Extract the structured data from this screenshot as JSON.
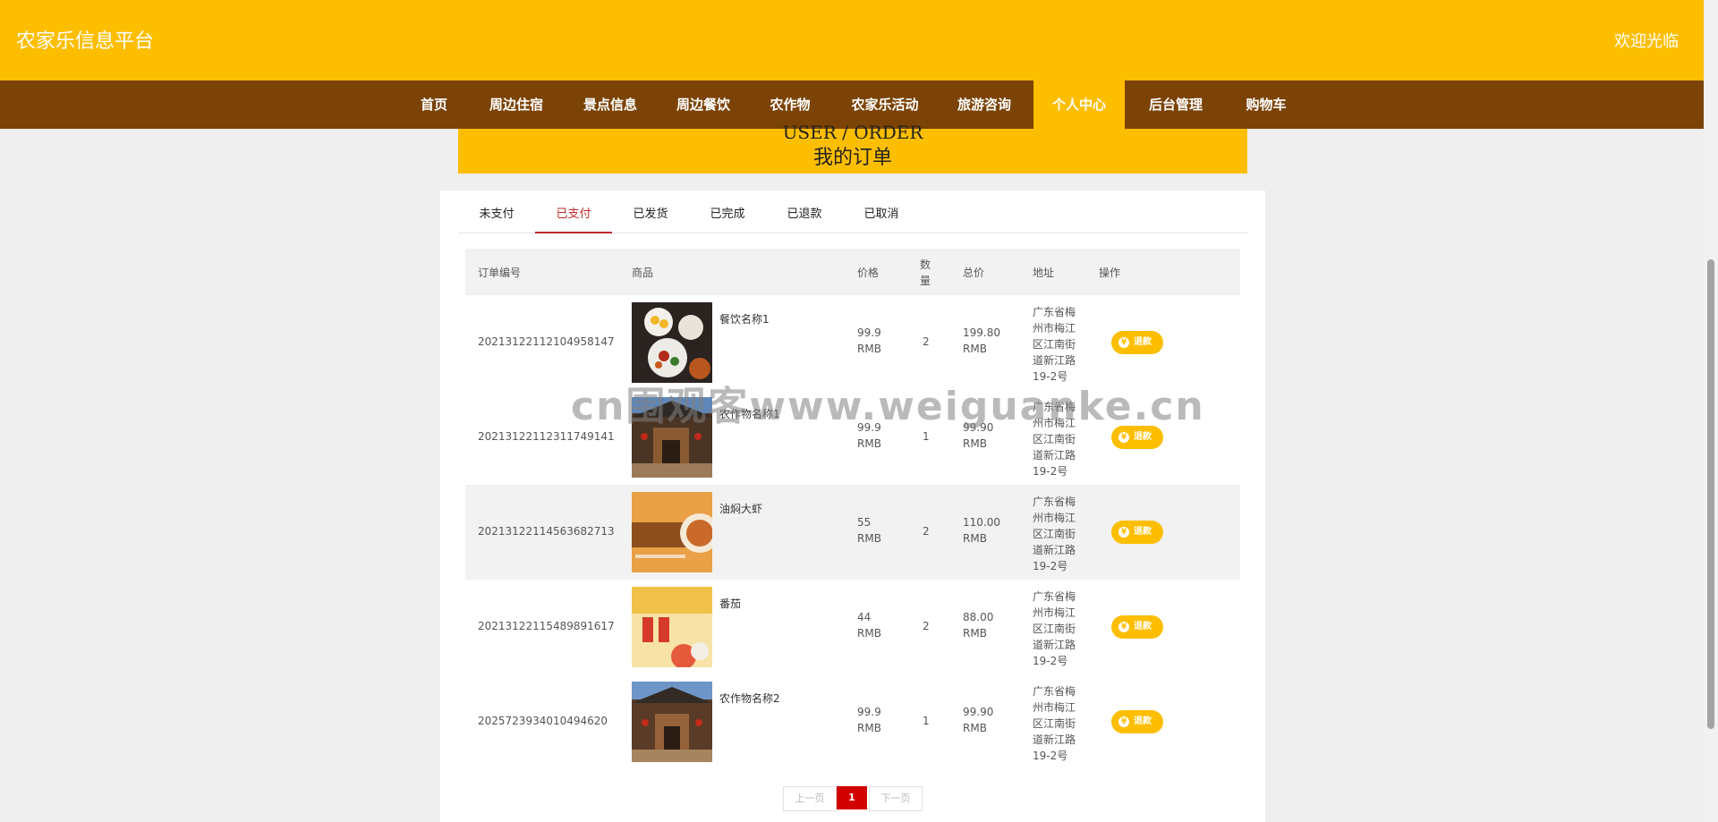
{
  "header": {
    "site_title": "农家乐信息平台",
    "welcome": "欢迎光临"
  },
  "nav": {
    "items": [
      {
        "label": "首页"
      },
      {
        "label": "周边住宿"
      },
      {
        "label": "景点信息"
      },
      {
        "label": "周边餐饮"
      },
      {
        "label": "农作物"
      },
      {
        "label": "农家乐活动"
      },
      {
        "label": "旅游咨询"
      },
      {
        "label": "个人中心",
        "active": true
      },
      {
        "label": "后台管理"
      },
      {
        "label": "购物车"
      }
    ]
  },
  "banner": {
    "en": "USER / ORDER",
    "cn": "我的订单"
  },
  "tabs": [
    {
      "label": "未支付"
    },
    {
      "label": "已支付",
      "active": true
    },
    {
      "label": "已发货"
    },
    {
      "label": "已完成"
    },
    {
      "label": "已退款"
    },
    {
      "label": "已取消"
    }
  ],
  "table": {
    "headers": {
      "order_no": "订单编号",
      "goods": "商品",
      "price": "价格",
      "qty_line1": "数",
      "qty_line2": "量",
      "total": "总价",
      "address": "地址",
      "action": "操作"
    },
    "rows": [
      {
        "order_no": "20213122112104958147",
        "goods": "餐饮名称1",
        "price": "99.9",
        "price_unit": "RMB",
        "qty": "2",
        "total": "199.80",
        "total_unit": "RMB",
        "address_lines": [
          "广东省梅",
          "州市梅江",
          "区江南街",
          "道新江路",
          "19-2号"
        ],
        "action": "退款"
      },
      {
        "order_no": "20213122112311749141",
        "goods": "农作物名称1",
        "price": "99.9",
        "price_unit": "RMB",
        "qty": "1",
        "total": "99.90",
        "total_unit": "RMB",
        "address_lines": [
          "广东省梅",
          "州市梅江",
          "区江南街",
          "道新江路",
          "19-2号"
        ],
        "action": "退款"
      },
      {
        "order_no": "20213122114563682713",
        "goods": "油焖大虾",
        "price": "55",
        "price_unit": "RMB",
        "qty": "2",
        "total": "110.00",
        "total_unit": "RMB",
        "address_lines": [
          "广东省梅",
          "州市梅江",
          "区江南街",
          "道新江路",
          "19-2号"
        ],
        "action": "退款"
      },
      {
        "order_no": "20213122115489891617",
        "goods": "番茄",
        "price": "44",
        "price_unit": "RMB",
        "qty": "2",
        "total": "88.00",
        "total_unit": "RMB",
        "address_lines": [
          "广东省梅",
          "州市梅江",
          "区江南街",
          "道新江路",
          "19-2号"
        ],
        "action": "退款"
      },
      {
        "order_no": "2025723934010494620",
        "goods": "农作物名称2",
        "price": "99.9",
        "price_unit": "RMB",
        "qty": "1",
        "total": "99.90",
        "total_unit": "RMB",
        "address_lines": [
          "广东省梅",
          "州市梅江",
          "区江南街",
          "道新江路",
          "19-2号"
        ],
        "action": "退款"
      }
    ]
  },
  "pagination": {
    "prev": "上一页",
    "current": "1",
    "next": "下一页"
  },
  "watermark": "cn围观客www.weiguanke.cn",
  "colors": {
    "brand_yellow": "#fdbe00",
    "nav_brown": "#7b4306",
    "active_tab_red": "#c0292b",
    "pager_red": "#d20000"
  }
}
